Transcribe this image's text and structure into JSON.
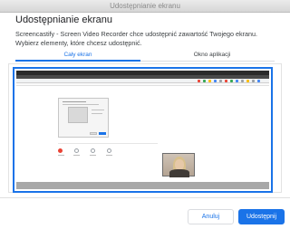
{
  "window": {
    "title": "Udostępnianie ekranu"
  },
  "dialog": {
    "heading": "Udostępnianie ekranu",
    "description": "Screencastify - Screen Video Recorder chce udostępnić zawartość Twojego ekranu. Wybierz elementy, które chcesz udostępnić."
  },
  "tabs": [
    {
      "label": "Cały ekran",
      "active": true
    },
    {
      "label": "Okno aplikacji",
      "active": false
    }
  ],
  "preview": {
    "selected": true
  },
  "buttons": {
    "cancel": "Anuluj",
    "share": "Udostępnij"
  },
  "colors": {
    "accent": "#1a73e8",
    "record": "#ea4335"
  }
}
